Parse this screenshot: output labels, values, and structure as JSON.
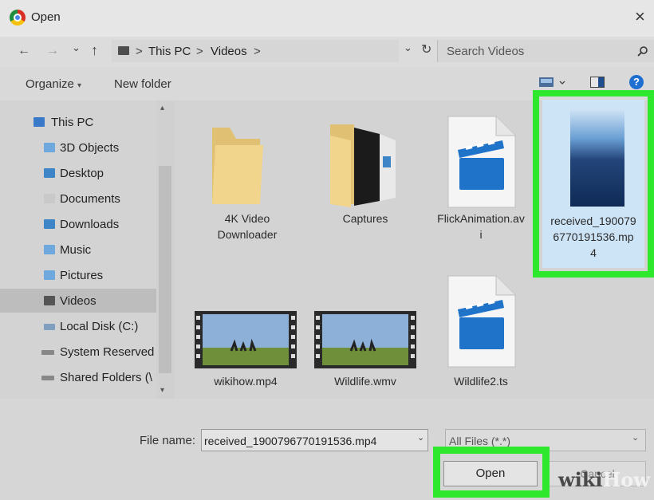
{
  "window": {
    "title": "Open",
    "close_glyph": "×"
  },
  "navigation": {
    "back_glyph": "←",
    "forward_glyph": "→",
    "recent_glyph": "⌄",
    "up_glyph": "↑",
    "breadcrumb": [
      "This PC",
      "Videos"
    ],
    "separator": ">",
    "dropdown_glyph": "⌄",
    "refresh_glyph": "↻"
  },
  "search": {
    "placeholder": "Search Videos",
    "icon": "search-icon"
  },
  "toolbar": {
    "organize_label": "Organize",
    "organize_caret": "▾",
    "new_folder_label": "New folder",
    "help_glyph": "?"
  },
  "sidebar": {
    "items": [
      {
        "label": "This PC",
        "icon": "pc-icon",
        "color": "#3a78c8"
      },
      {
        "label": "3D Objects",
        "icon": "cube-icon",
        "color": "#6fa8dc"
      },
      {
        "label": "Desktop",
        "icon": "desktop-icon",
        "color": "#3d85c6"
      },
      {
        "label": "Documents",
        "icon": "documents-icon",
        "color": "#c9c9c9"
      },
      {
        "label": "Downloads",
        "icon": "download-icon",
        "color": "#3d85c6"
      },
      {
        "label": "Music",
        "icon": "music-icon",
        "color": "#6fa8dc"
      },
      {
        "label": "Pictures",
        "icon": "pictures-icon",
        "color": "#6fa8dc"
      },
      {
        "label": "Videos",
        "icon": "videos-icon",
        "color": "#555555",
        "selected": true
      },
      {
        "label": "Local Disk (C:)",
        "icon": "disk-icon",
        "color": "#7f9fbf"
      },
      {
        "label": "System Reserved",
        "icon": "drive-icon",
        "color": "#888888"
      },
      {
        "label": "Shared Folders (\\",
        "icon": "network-drive-icon",
        "color": "#888888"
      }
    ]
  },
  "files": [
    {
      "name_lines": [
        "4K Video",
        "Downloader"
      ],
      "type": "folder"
    },
    {
      "name_lines": [
        "Captures"
      ],
      "type": "folder-open"
    },
    {
      "name_lines": [
        "FlickAnimation.av",
        "i"
      ],
      "type": "video-file"
    },
    {
      "name_lines": [
        "received_190079",
        "6770191536.mp",
        "4"
      ],
      "type": "video-preview",
      "selected": true
    },
    {
      "name_lines": [
        "wikihow.mp4"
      ],
      "type": "video-thumb"
    },
    {
      "name_lines": [
        "Wildlife.wmv"
      ],
      "type": "video-thumb"
    },
    {
      "name_lines": [
        "Wildlife2.ts"
      ],
      "type": "video-file"
    }
  ],
  "footer": {
    "file_name_label": "File name:",
    "file_name_value": "received_1900796770191536.mp4",
    "filter_value": "All Files (*.*)",
    "open_label": "Open",
    "cancel_label": "Cancel"
  },
  "watermark": {
    "part1": "wiki",
    "part2": "How"
  },
  "colors": {
    "highlight": "#2ee82e",
    "selection_bg": "#cde4f7",
    "help": "#1f6fd1"
  }
}
